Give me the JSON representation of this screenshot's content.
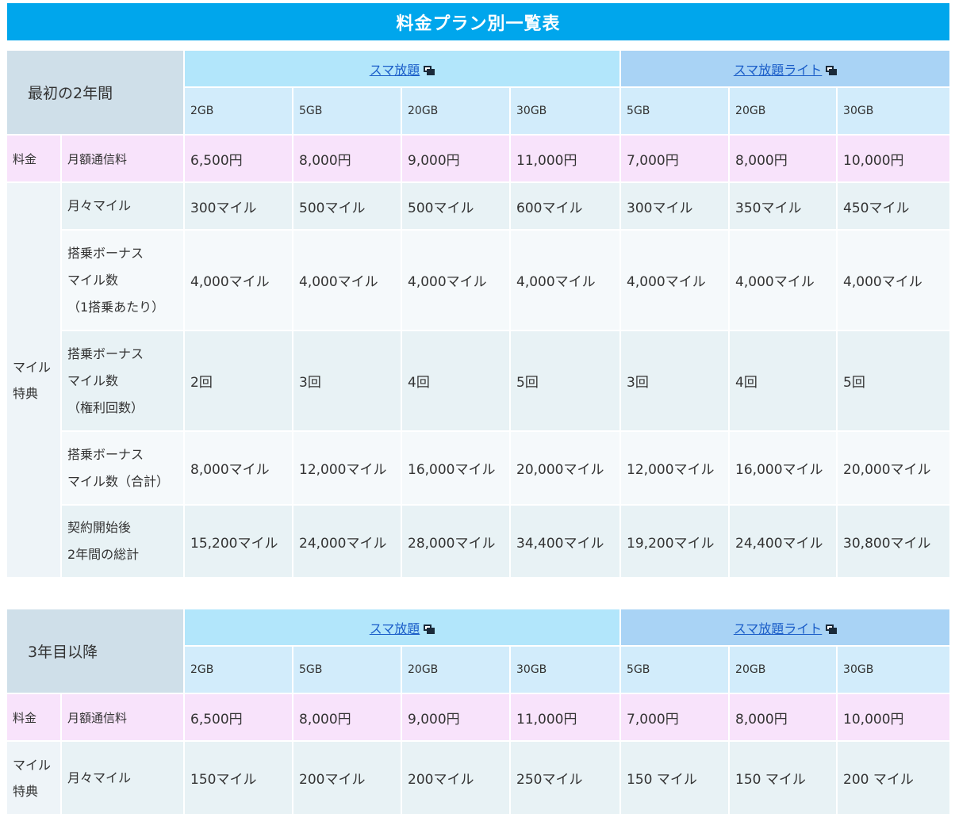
{
  "title": "料金プラン別一覧表",
  "colors": {
    "title_bg": "#00a6ec",
    "plan_a_bg": "#b2e6fb",
    "plan_b_bg": "#a9d3f5",
    "fee_bg": "#f8e3fb",
    "link": "#1a5dc8"
  },
  "icons": {
    "external_link": "external-link-icon"
  },
  "table1": {
    "corner": "最初の2年間",
    "plan_a": "スマ放題",
    "plan_b": "スマ放題ライト",
    "capacities": [
      "2GB",
      "5GB",
      "20GB",
      "30GB",
      "5GB",
      "20GB",
      "30GB"
    ],
    "fee_group": "料金",
    "fee_label": "月額通信料",
    "fees": [
      "6,500円",
      "8,000円",
      "9,000円",
      "11,000円",
      "7,000円",
      "8,000円",
      "10,000円"
    ],
    "mile_group": [
      "マイル",
      "特典"
    ],
    "rows": [
      {
        "label": [
          "月々マイル"
        ],
        "values": [
          "300マイル",
          "500マイル",
          "500マイル",
          "600マイル",
          "300マイル",
          "350マイル",
          "450マイル"
        ]
      },
      {
        "label": [
          "搭乗ボーナス",
          "マイル数",
          "（1搭乗あたり）"
        ],
        "values": [
          "4,000マイル",
          "4,000マイル",
          "4,000マイル",
          "4,000マイル",
          "4,000マイル",
          "4,000マイル",
          "4,000マイル"
        ]
      },
      {
        "label": [
          "搭乗ボーナス",
          "マイル数",
          "（権利回数）"
        ],
        "values": [
          "2回",
          "3回",
          "4回",
          "5回",
          "3回",
          "4回",
          "5回"
        ]
      },
      {
        "label": [
          "搭乗ボーナス",
          "マイル数（合計）"
        ],
        "values": [
          "8,000マイル",
          "12,000マイル",
          "16,000マイル",
          "20,000マイル",
          "12,000マイル",
          "16,000マイル",
          "20,000マイル"
        ]
      },
      {
        "label": [
          "契約開始後",
          "2年間の総計"
        ],
        "values": [
          "15,200マイル",
          "24,000マイル",
          "28,000マイル",
          "34,400マイル",
          "19,200マイル",
          "24,400マイル",
          "30,800マイル"
        ]
      }
    ]
  },
  "table2": {
    "corner": "3年目以降",
    "plan_a": "スマ放題",
    "plan_b": "スマ放題ライト",
    "capacities": [
      "2GB",
      "5GB",
      "20GB",
      "30GB",
      "5GB",
      "20GB",
      "30GB"
    ],
    "fee_group": "料金",
    "fee_label": "月額通信料",
    "fees": [
      "6,500円",
      "8,000円",
      "9,000円",
      "11,000円",
      "7,000円",
      "8,000円",
      "10,000円"
    ],
    "mile_group": [
      "マイル",
      "特典"
    ],
    "rows": [
      {
        "label": [
          "月々マイル"
        ],
        "values": [
          "150マイル",
          "200マイル",
          "200マイル",
          "250マイル",
          "150 マイル",
          "150 マイル",
          "200 マイル"
        ]
      }
    ]
  }
}
